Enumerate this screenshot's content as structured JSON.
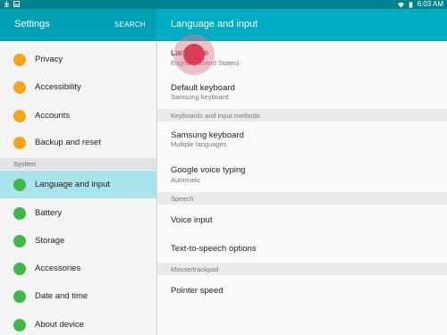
{
  "status_bar": {
    "time": "6:03 AM",
    "icons": [
      "download-icon",
      "image-icon",
      "wifi-icon",
      "battery-icon"
    ]
  },
  "left_pane": {
    "title": "Settings",
    "search_label": "SEARCH",
    "items_top": [
      {
        "label": "Privacy",
        "icon": "privacy-icon",
        "color": "#f6a21a"
      },
      {
        "label": "Accessibility",
        "icon": "accessibility-icon",
        "color": "#f6a21a"
      },
      {
        "label": "Accounts",
        "icon": "key-icon",
        "color": "#f6a21a"
      },
      {
        "label": "Backup and reset",
        "icon": "backup-icon",
        "color": "#f6a21a"
      }
    ],
    "section_system": "System",
    "items_system": [
      {
        "label": "Language and input",
        "icon": "language-icon",
        "color": "#41b649",
        "active": true
      },
      {
        "label": "Battery",
        "icon": "battery-icon",
        "color": "#41b649"
      },
      {
        "label": "Storage",
        "icon": "storage-icon",
        "color": "#41b649"
      },
      {
        "label": "Accessories",
        "icon": "accessories-icon",
        "color": "#41b649"
      },
      {
        "label": "Date and time",
        "icon": "calendar-icon",
        "color": "#41b649"
      },
      {
        "label": "About device",
        "icon": "info-icon",
        "color": "#41b649"
      }
    ]
  },
  "right_pane": {
    "title": "Language and input",
    "language": {
      "title": "Language",
      "subtitle": "English (United States)"
    },
    "default_keyboard": {
      "title": "Default keyboard",
      "subtitle": "Samsung keyboard"
    },
    "section_keyboards": "Keyboards and input methods",
    "samsung_keyboard": {
      "title": "Samsung keyboard",
      "subtitle": "Multiple languages"
    },
    "google_voice": {
      "title": "Google voice typing",
      "subtitle": "Automatic"
    },
    "section_speech": "Speech",
    "voice_input": {
      "title": "Voice input"
    },
    "tts": {
      "title": "Text-to-speech options"
    },
    "section_mouse": "Mouse/trackpad",
    "pointer_speed": {
      "title": "Pointer speed"
    }
  },
  "colors": {
    "appbar_left": "#00a0b4",
    "appbar_right": "#00acc1",
    "active_row": "#a9e3ec",
    "touch_indicator": "#dc3d56"
  }
}
